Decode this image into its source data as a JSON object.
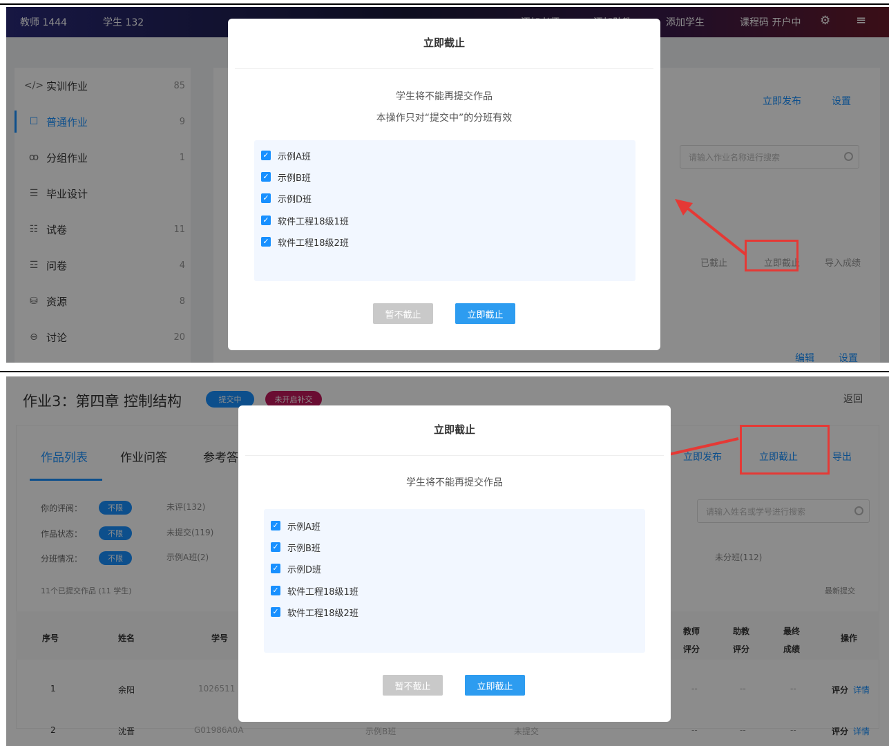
{
  "panel1": {
    "topbar": {
      "teachers": "教师 1444",
      "students": "学生 132",
      "add_teacher": "添加老师",
      "add_assistant": "添加助教",
      "add_student": "添加学生",
      "course_status": "课程码 开户中"
    },
    "sidebar": {
      "items": [
        {
          "icon": "</>",
          "label": "实训作业",
          "count": "85"
        },
        {
          "icon": "☐",
          "label": "普通作业",
          "count": "9"
        },
        {
          "icon": "ꝏ",
          "label": "分组作业",
          "count": "1"
        },
        {
          "icon": "☰",
          "label": "毕业设计",
          "count": ""
        },
        {
          "icon": "☷",
          "label": "试卷",
          "count": "11"
        },
        {
          "icon": "☲",
          "label": "问卷",
          "count": "4"
        },
        {
          "icon": "⛁",
          "label": "资源",
          "count": "8"
        },
        {
          "icon": "⊖",
          "label": "讨论",
          "count": "20"
        }
      ]
    },
    "right": {
      "publish_link": "立即发布",
      "settings_link": "设置",
      "search_placeholder": "请输入作业名称进行搜索",
      "tab_a": "已截止",
      "tab_b": "立即截止",
      "tab_c": "导入成绩",
      "bottom_link_a": "编辑",
      "bottom_link_b": "设置"
    },
    "modal": {
      "title": "立即截止",
      "desc_line1": "学生将不能再提交作品",
      "desc_line2": "本操作只对“提交中”的分班有效",
      "classes": [
        "示例A班",
        "示例B班",
        "示例D班",
        "软件工程18级1班",
        "软件工程18级2班"
      ],
      "cancel_label": "暂不截止",
      "confirm_label": "立即截止"
    }
  },
  "panel2": {
    "page_title": "作业3：第四章 控制结构",
    "tag_a": "提交中",
    "tag_b": "未开启补交",
    "back_link": "返回",
    "tabs": [
      "作品列表",
      "作业问答",
      "参考答案"
    ],
    "actions": {
      "publish": "立即发布",
      "close_now": "立即截止",
      "export": "导出"
    },
    "filters": [
      {
        "label": "你的评阅：",
        "pill": "不限",
        "opt": "未评(132)"
      },
      {
        "label": "作品状态：",
        "pill": "不限",
        "opt": "未提交(119)"
      },
      {
        "label": "分班情况：",
        "pill": "不限",
        "opt": "示例A班(2)"
      }
    ],
    "filter_right_opt": "未分班(112)",
    "search_placeholder": "请输入姓名或学号进行搜索",
    "summary": "11个已提交作品 (11 学生)",
    "sort_label": "最新提交",
    "table_headers": [
      "序号",
      "姓名",
      "学号",
      "教师评分",
      "助教评分",
      "最终成绩",
      "操作"
    ],
    "rows": [
      {
        "idx": "1",
        "name": "余阳",
        "sid": "1026511",
        "t": "--",
        "a": "--",
        "f": "--",
        "op_a": "评分",
        "op_b": "详情"
      },
      {
        "idx": "2",
        "name": "沈晋",
        "sid": "G01986A0A",
        "cls": "示例B班",
        "status": "未提交",
        "t": "--",
        "a": "--",
        "f": "--",
        "op_a": "评分",
        "op_b": "详情"
      }
    ],
    "modal": {
      "title": "立即截止",
      "desc_line1": "学生将不能再提交作品",
      "classes": [
        "示例A班",
        "示例B班",
        "示例D班",
        "软件工程18级1班",
        "软件工程18级2班"
      ],
      "cancel_label": "暂不截止",
      "confirm_label": "立即截止"
    }
  },
  "colors": {
    "accent": "#1890ff",
    "annotation_red": "#e53935",
    "confirm_button": "#2d9cf0",
    "disabled_button": "#c9c9c9"
  }
}
